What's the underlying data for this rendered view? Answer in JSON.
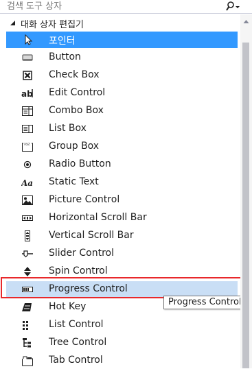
{
  "search": {
    "placeholder": "검색 도구 상자"
  },
  "group": {
    "label": "대화 상자 편집기"
  },
  "items": [
    {
      "label": "포인터",
      "icon": "pointer-icon"
    },
    {
      "label": "Button",
      "icon": "button-icon"
    },
    {
      "label": "Check Box",
      "icon": "checkbox-icon"
    },
    {
      "label": "Edit Control",
      "icon": "edit-control-icon"
    },
    {
      "label": "Combo Box",
      "icon": "combo-box-icon"
    },
    {
      "label": "List Box",
      "icon": "list-box-icon"
    },
    {
      "label": "Group Box",
      "icon": "group-box-icon"
    },
    {
      "label": "Radio Button",
      "icon": "radio-button-icon"
    },
    {
      "label": "Static Text",
      "icon": "static-text-icon"
    },
    {
      "label": "Picture Control",
      "icon": "picture-control-icon"
    },
    {
      "label": "Horizontal Scroll Bar",
      "icon": "horizontal-scroll-bar-icon"
    },
    {
      "label": "Vertical Scroll Bar",
      "icon": "vertical-scroll-bar-icon"
    },
    {
      "label": "Slider Control",
      "icon": "slider-control-icon"
    },
    {
      "label": "Spin Control",
      "icon": "spin-control-icon"
    },
    {
      "label": "Progress Control",
      "icon": "progress-control-icon"
    },
    {
      "label": "Hot Key",
      "icon": "hot-key-icon"
    },
    {
      "label": "List Control",
      "icon": "list-control-icon"
    },
    {
      "label": "Tree Control",
      "icon": "tree-control-icon"
    },
    {
      "label": "Tab Control",
      "icon": "tab-control-icon"
    }
  ],
  "selected_item": "포인터",
  "hovered_item": "Progress Control",
  "tooltip": {
    "text": "Progress Control"
  },
  "colors": {
    "selection": "#3399ff",
    "hover": "#c9def5",
    "annotation": "#e8282b"
  }
}
